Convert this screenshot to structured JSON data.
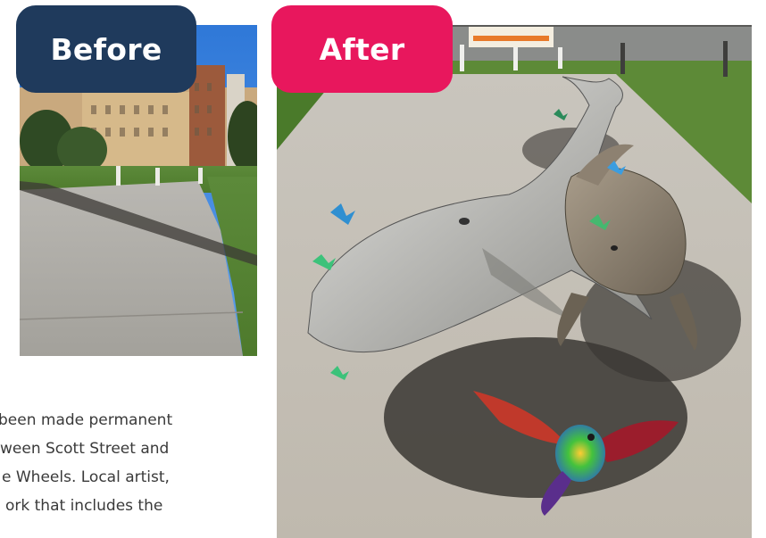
{
  "labels": {
    "before": "Before",
    "after": "After"
  },
  "article": {
    "lines": [
      "been made permanent",
      "ween Scott Street and",
      "e Wheels. Local artist,",
      "ork that includes the"
    ]
  },
  "colors": {
    "before_badge": "#1f3a5c",
    "after_badge": "#e8175d",
    "text": "#3a3a3a"
  }
}
